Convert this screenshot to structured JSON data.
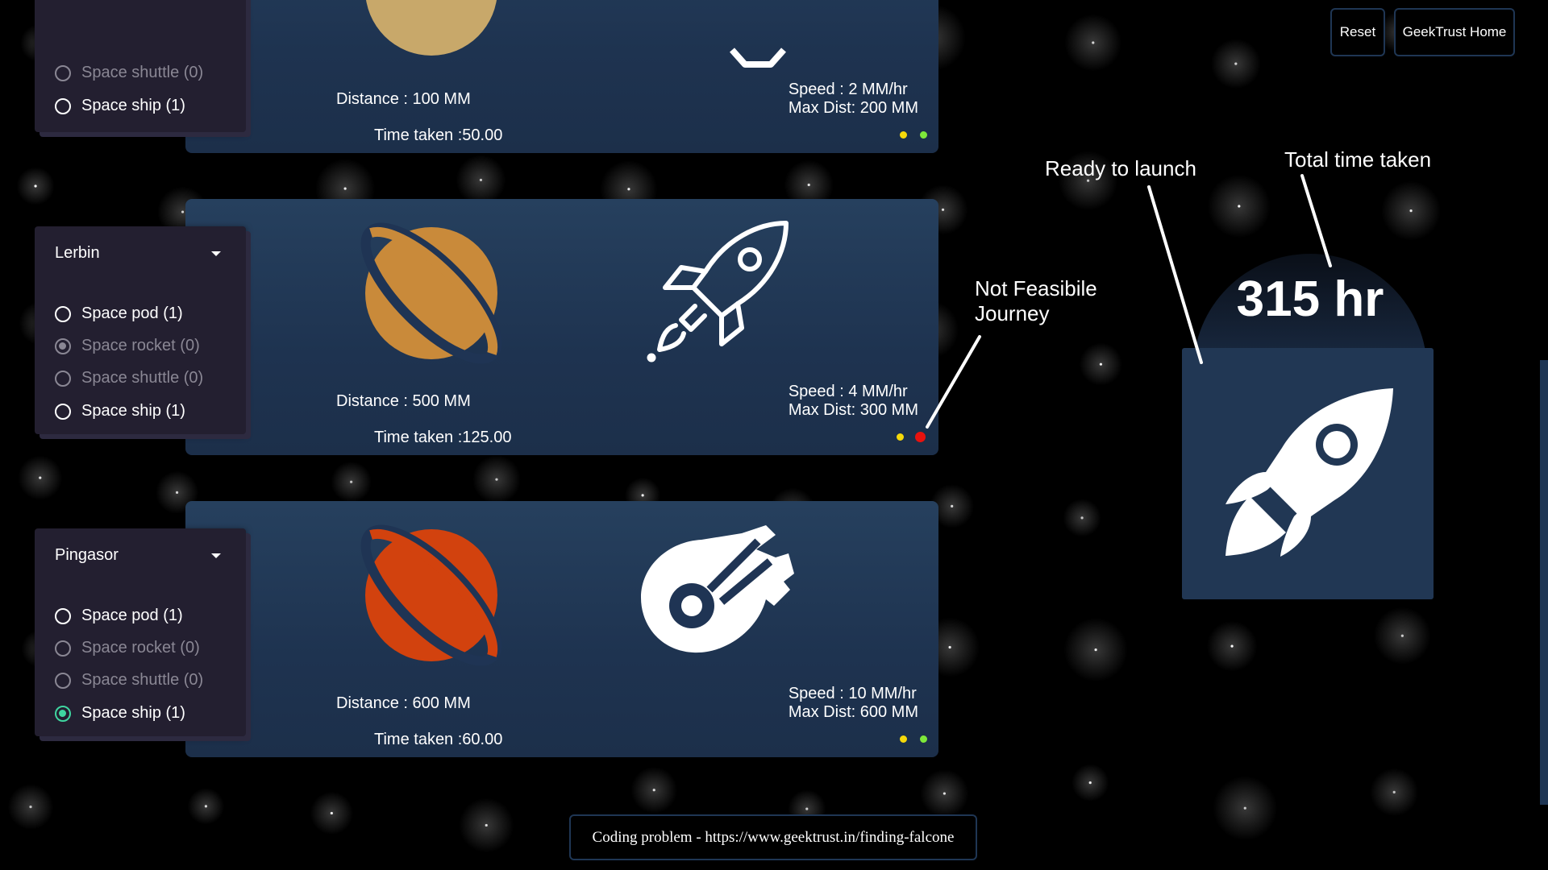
{
  "header": {
    "reset_label": "Reset",
    "home_label": "GeekTrust Home"
  },
  "destinations": [
    {
      "planet": "",
      "planet_color": "#c8a86a",
      "vehicle_icon": "space-ship-icon",
      "options": [
        {
          "label": "Space shuttle (0)",
          "state": "disabled"
        },
        {
          "label": "Space ship (1)",
          "state": "unchecked"
        }
      ],
      "distance": "Distance : 100 MM",
      "time": "Time taken :50.00",
      "speed": "Speed : 2 MM/hr",
      "max_dist": "Max Dist: 200 MM",
      "status_dots": [
        "#f5d90a",
        "#7ee83a"
      ]
    },
    {
      "planet": "Lerbin",
      "planet_color": "#c98a3a",
      "vehicle_icon": "space-rocket-icon",
      "options": [
        {
          "label": "Space pod (1)",
          "state": "unchecked"
        },
        {
          "label": "Space rocket (0)",
          "state": "disabled-checked"
        },
        {
          "label": "Space shuttle (0)",
          "state": "disabled"
        },
        {
          "label": "Space ship (1)",
          "state": "unchecked"
        }
      ],
      "distance": "Distance : 500 MM",
      "time": "Time taken :125.00",
      "speed": "Speed : 4 MM/hr",
      "max_dist": "Max Dist: 300 MM",
      "status_dots": [
        "#f5d90a",
        "#e8120e"
      ]
    },
    {
      "planet": "Pingasor",
      "planet_color": "#d2420e",
      "vehicle_icon": "space-ship-icon",
      "options": [
        {
          "label": "Space pod (1)",
          "state": "unchecked"
        },
        {
          "label": "Space rocket (0)",
          "state": "disabled"
        },
        {
          "label": "Space shuttle (0)",
          "state": "disabled"
        },
        {
          "label": "Space ship (1)",
          "state": "checked"
        }
      ],
      "distance": "Distance : 600 MM",
      "time": "Time taken :60.00",
      "speed": "Speed : 10 MM/hr",
      "max_dist": "Max Dist: 600 MM",
      "status_dots": [
        "#f5d90a",
        "#7ee83a"
      ]
    }
  ],
  "annotations": {
    "ready": "Ready to launch",
    "total": "Total time taken",
    "not_feasible_line1": "Not Feasibile",
    "not_feasible_line2": "Journey"
  },
  "summary": {
    "total_time": "315 hr",
    "launch_icon": "rocket-launch-icon"
  },
  "footer": {
    "text": "Coding problem - https://www.geektrust.in/finding-falcone"
  },
  "colors": {
    "card": "#1e3350",
    "accent_green": "#3fd6a0",
    "infeasible_red": "#e8120e"
  }
}
